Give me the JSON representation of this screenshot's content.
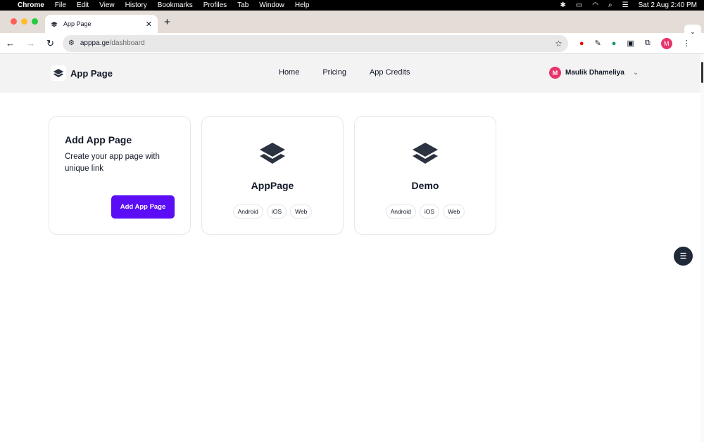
{
  "menubar": {
    "app": "Chrome",
    "items": [
      "File",
      "Edit",
      "View",
      "History",
      "Bookmarks",
      "Profiles",
      "Tab",
      "Window",
      "Help"
    ],
    "datetime": "Sat 2 Aug  2:40 PM"
  },
  "browser": {
    "tab_title": "App Page",
    "url_host": "apppa.ge",
    "url_path": "/dashboard",
    "profile_initial": "M"
  },
  "header": {
    "brand": "App Page",
    "nav": [
      "Home",
      "Pricing",
      "App Credits"
    ],
    "user_name": "Maulik Dhameliya",
    "user_initial": "M"
  },
  "add_card": {
    "title": "Add App Page",
    "description": "Create your app page with unique link",
    "button": "Add App Page"
  },
  "apps": [
    {
      "name": "AppPage",
      "tags": [
        "Android",
        "iOS",
        "Web"
      ]
    },
    {
      "name": "Demo",
      "tags": [
        "Android",
        "iOS",
        "Web"
      ]
    }
  ],
  "colors": {
    "accent": "#5b0df5",
    "avatar": "#e8336b"
  }
}
